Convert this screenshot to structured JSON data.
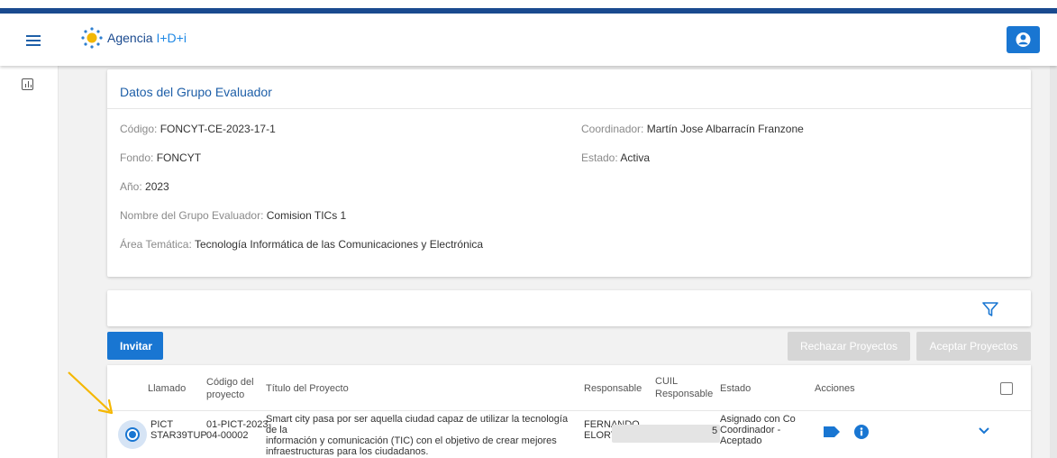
{
  "header": {
    "brand_main": "Agencia ",
    "brand_accent": "I+D+i"
  },
  "info": {
    "title": "Datos del Grupo Evaluador",
    "codigo_label": "Código: ",
    "codigo": "FONCYT-CE-2023-17-1",
    "fondo_label": "Fondo: ",
    "fondo": "FONCYT",
    "anio_label": "Año: ",
    "anio": "2023",
    "nombre_label": "Nombre del Grupo Evaluador: ",
    "nombre": "Comision TICs 1",
    "area_label": "Área Temática: ",
    "area": "Tecnología Informática de las Comunicaciones y Electrónica",
    "coordinador_label": "Coordinador: ",
    "coordinador": "Martín Jose Albarracín Franzone",
    "estado_label": "Estado: ",
    "estado": "Activa"
  },
  "actions": {
    "invitar": "Invitar",
    "rechazar": "Rechazar Proyectos",
    "aceptar": "Aceptar Proyectos"
  },
  "table": {
    "columns": {
      "llamado": "Llamado",
      "codigo_1": "Código del",
      "codigo_2": "proyecto",
      "titulo": "Título del Proyecto",
      "responsable": "Responsable",
      "cuil_1": "CUIL",
      "cuil_2": "Responsable",
      "estado": "Estado",
      "acciones": "Acciones"
    },
    "row": {
      "llamado_1": "PICT",
      "llamado_2": "STAR39TUP",
      "codigo_1": "01-PICT-2023-",
      "codigo_2": "04-00002",
      "titulo_1": "Smart city pasa por ser aquella ciudad capaz de utilizar la tecnología de la",
      "titulo_2": "información y comunicación (TIC) con el objetivo de crear mejores",
      "titulo_3": "infraestructuras para los ciudadanos.",
      "responsable_1": "FERNANDO",
      "responsable_2": "ELORTEGUI",
      "cuil_tail": "5",
      "estado_1": "Asignado con Co",
      "estado_2": "Coordinador -",
      "estado_3": "Aceptado"
    }
  },
  "colors": {
    "primary": "#1976d2",
    "navy": "#1a4a8f",
    "annotation_arrow": "#f5b700"
  },
  "icons": [
    "menu-icon",
    "agency-logo-icon",
    "user-icon",
    "chart-icon",
    "filter-icon",
    "tag-icon",
    "info-icon",
    "chevron-down-icon",
    "arrow-annotation"
  ]
}
